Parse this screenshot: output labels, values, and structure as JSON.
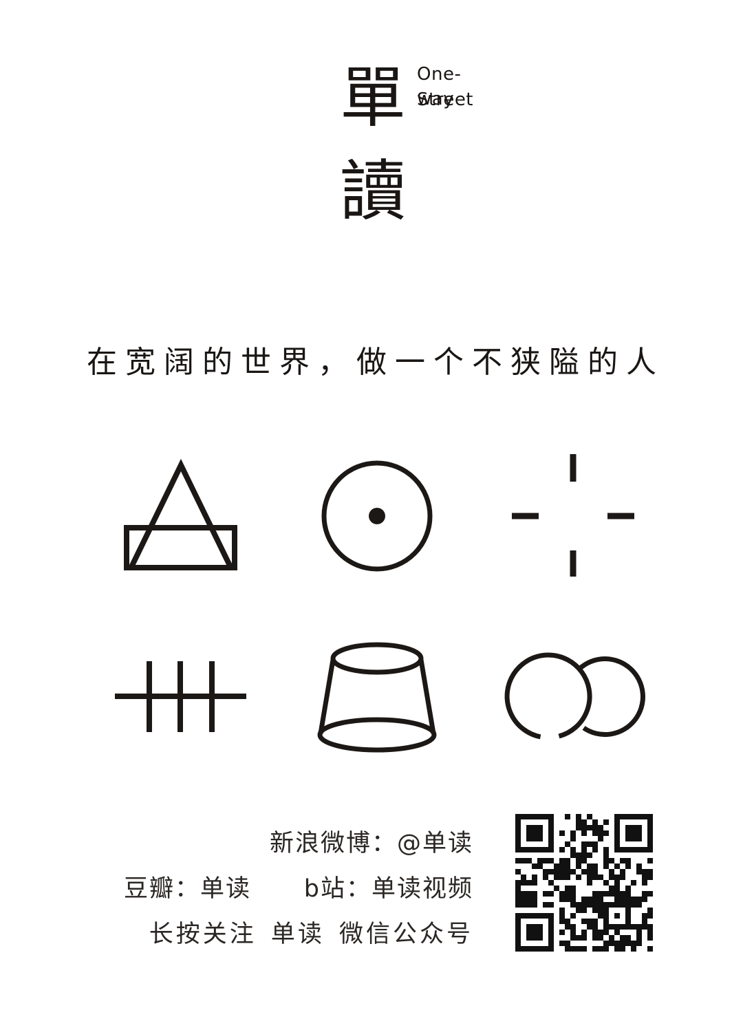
{
  "logo": {
    "char_top": "單",
    "char_bottom": "讀",
    "english_line1": "One-way",
    "english_line2": "Street"
  },
  "slogan": "在宽阔的世界，做一个不狭隘的人",
  "symbols": [
    "triangle-over-rectangle-icon",
    "circle-dot-icon",
    "crosshair-icon",
    "tally-marks-icon",
    "truncated-cone-icon",
    "interlocking-rings-icon"
  ],
  "contacts": {
    "weibo": "新浪微博：@单读",
    "douban": "豆瓣：单读",
    "bilibili": "b站：单读视频",
    "wechat": "长按关注 单读 微信公众号"
  },
  "qr_icon": "qr-code-icon",
  "colors": {
    "background": "#ffffff",
    "ink": "#1c1816"
  }
}
